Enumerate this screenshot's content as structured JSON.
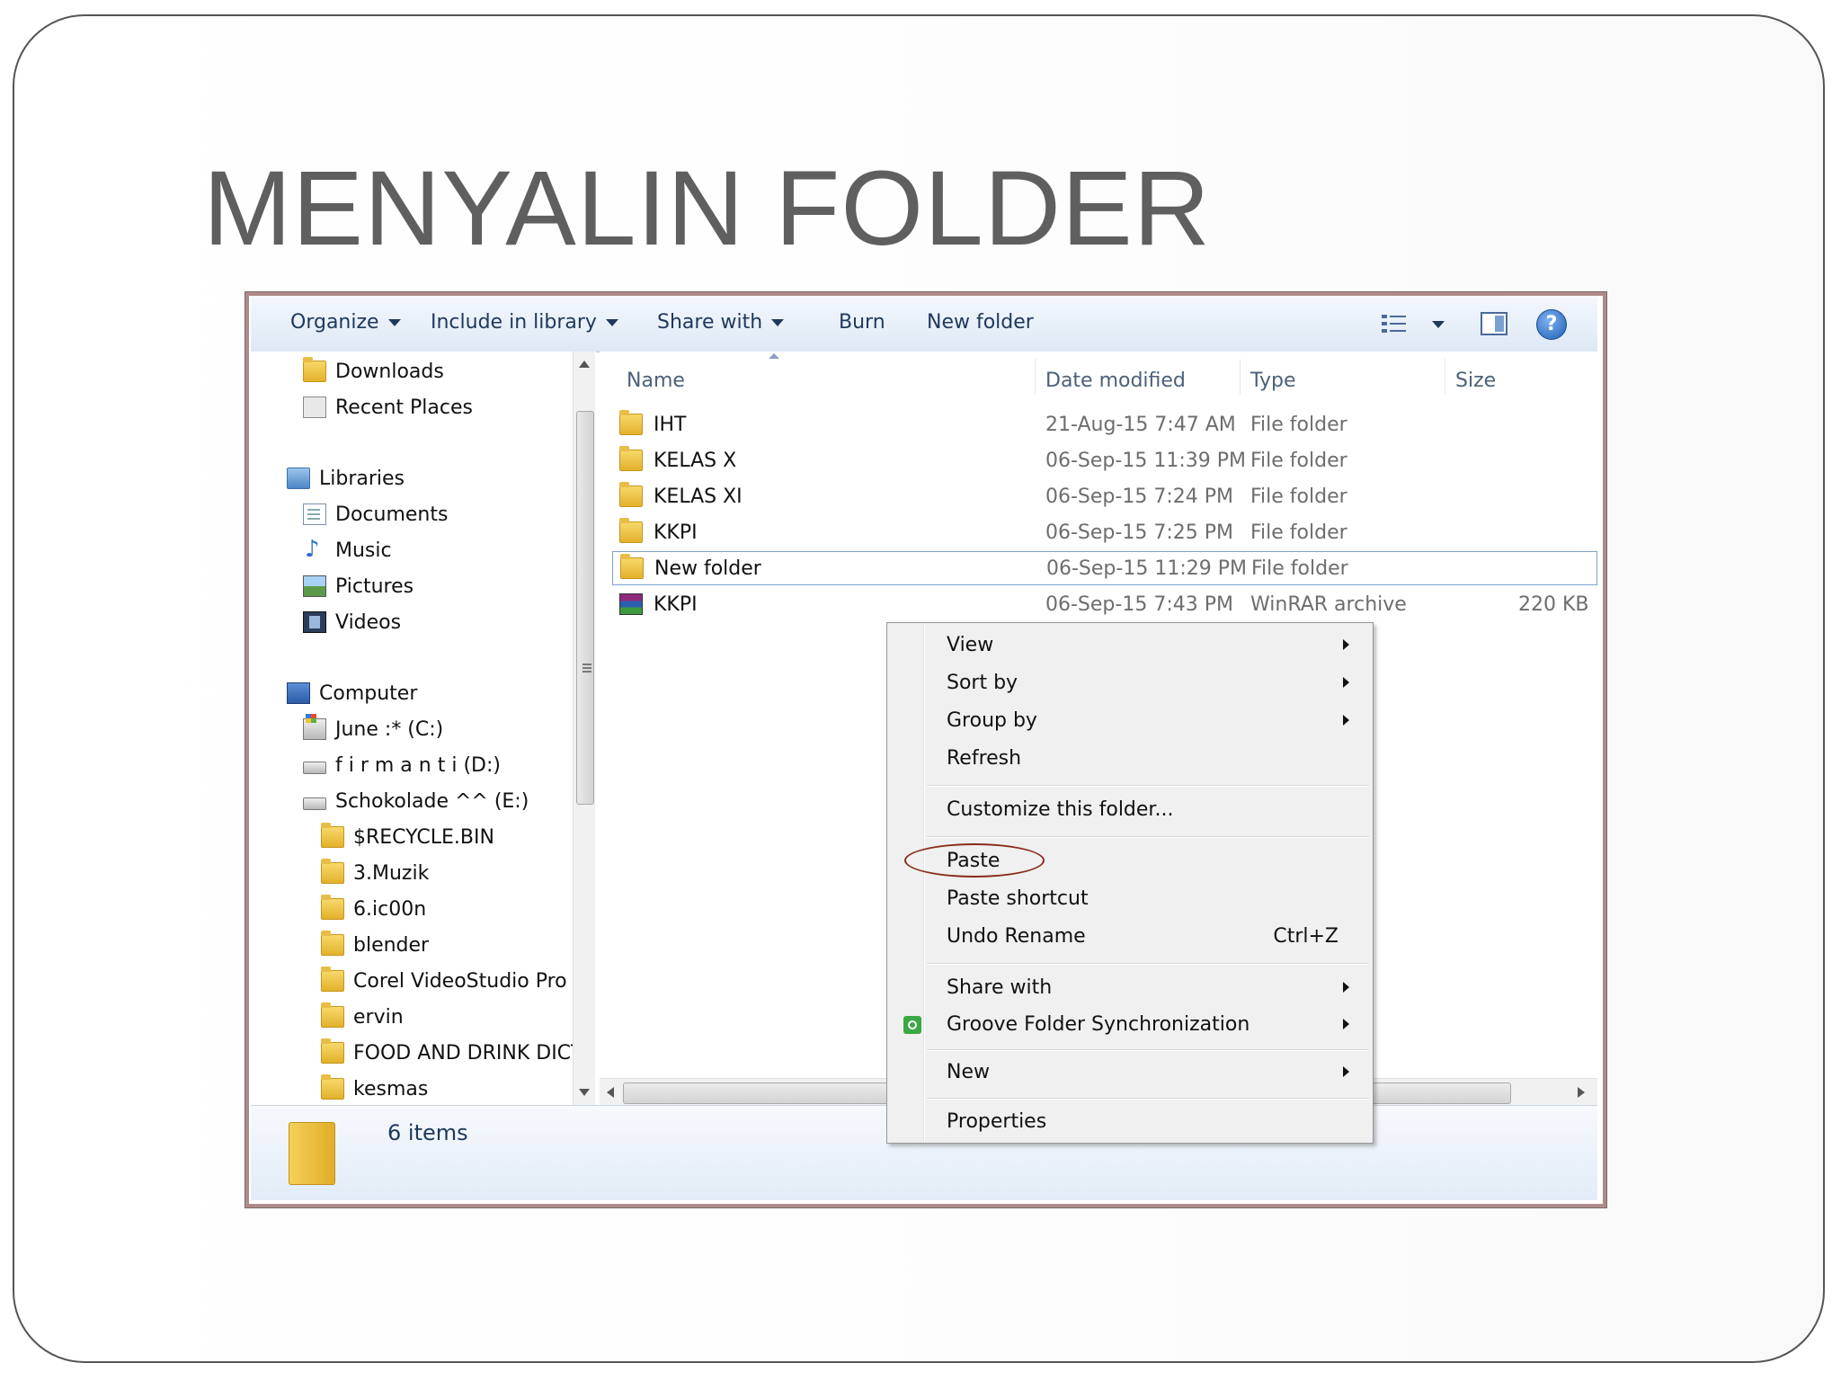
{
  "slide": {
    "title": "MENYALIN FOLDER"
  },
  "toolbar": {
    "organize": "Organize",
    "include_in_library": "Include in library",
    "share_with": "Share with",
    "burn": "Burn",
    "new_folder": "New folder",
    "help": "?"
  },
  "nav": {
    "items": [
      {
        "label": "Downloads",
        "icon": "downloads-icon"
      },
      {
        "label": "Recent Places",
        "icon": "recent-places-icon"
      },
      {
        "label": "Libraries",
        "icon": "libraries-icon"
      },
      {
        "label": "Documents",
        "icon": "documents-icon"
      },
      {
        "label": "Music",
        "icon": "music-icon"
      },
      {
        "label": "Pictures",
        "icon": "pictures-icon"
      },
      {
        "label": "Videos",
        "icon": "videos-icon"
      },
      {
        "label": "Computer",
        "icon": "computer-icon"
      },
      {
        "label": "June :* (C:)",
        "icon": "windows-drive-icon"
      },
      {
        "label": "f i r m a n t i (D:)",
        "icon": "drive-icon"
      },
      {
        "label": "Schokolade ^^ (E:)",
        "icon": "drive-icon"
      },
      {
        "label": "$RECYCLE.BIN",
        "icon": "folder-icon"
      },
      {
        "label": "3.Muzik",
        "icon": "folder-icon"
      },
      {
        "label": "6.ic00n",
        "icon": "folder-icon"
      },
      {
        "label": "blender",
        "icon": "folder-icon"
      },
      {
        "label": "Corel VideoStudio Pro X",
        "icon": "folder-icon"
      },
      {
        "label": "ervin",
        "icon": "folder-icon"
      },
      {
        "label": "FOOD AND DRINK DICT",
        "icon": "folder-icon"
      },
      {
        "label": "kesmas",
        "icon": "folder-icon"
      }
    ]
  },
  "columns": {
    "name": "Name",
    "date_modified": "Date modified",
    "type": "Type",
    "size": "Size"
  },
  "files": [
    {
      "name": "IHT",
      "date": "21-Aug-15 7:47 AM",
      "type": "File folder",
      "size": ""
    },
    {
      "name": "KELAS X",
      "date": "06-Sep-15 11:39 PM",
      "type": "File folder",
      "size": ""
    },
    {
      "name": "KELAS XI",
      "date": "06-Sep-15 7:24 PM",
      "type": "File folder",
      "size": ""
    },
    {
      "name": "KKPI",
      "date": "06-Sep-15 7:25 PM",
      "type": "File folder",
      "size": ""
    },
    {
      "name": "New folder",
      "date": "06-Sep-15 11:29 PM",
      "type": "File folder",
      "size": ""
    },
    {
      "name": "KKPI",
      "date": "06-Sep-15 7:43 PM",
      "type": "WinRAR archive",
      "size": "220 KB"
    }
  ],
  "status": {
    "item_count": "6 items"
  },
  "context_menu": {
    "view": "View",
    "sort_by": "Sort by",
    "group_by": "Group by",
    "refresh": "Refresh",
    "customize": "Customize this folder...",
    "paste": "Paste",
    "paste_shortcut": "Paste shortcut",
    "undo_rename": "Undo Rename",
    "undo_shortcut": "Ctrl+Z",
    "share_with": "Share with",
    "groove": "Groove Folder Synchronization",
    "new": "New",
    "properties": "Properties"
  },
  "colors": {
    "title": "#5f5f5f",
    "toolbar_text": "#1e395b",
    "highlight_ellipse": "#8b2a1a",
    "selection_border": "#7da2ce"
  }
}
